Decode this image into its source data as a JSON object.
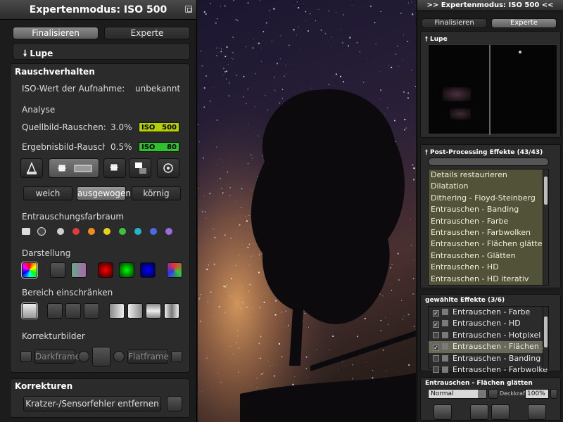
{
  "left": {
    "title": "Expertenmodus: ISO 500",
    "tabs": [
      {
        "label": "Finalisieren",
        "active": true
      },
      {
        "label": "Experte",
        "active": false
      }
    ],
    "lupe": "🠗 Lupe",
    "rausch": {
      "heading": "Rauschverhalten",
      "iso_label": "ISO-Wert der Aufnahme:",
      "iso_value": "unbekannt",
      "analyse": "Analyse",
      "quell_label": "Quellbild-Rauschen:",
      "quell_value": "3.0%",
      "quell_meter": {
        "iso": "ISO",
        "num": "500",
        "color": "#b4d000"
      },
      "ergeb_label": "Ergebnisbild-Rauschen:",
      "ergeb_value": "0.5%",
      "ergeb_meter": {
        "iso": "ISO",
        "num": "80",
        "color": "#2fc22f"
      },
      "grain_buttons": [
        "weich",
        "ausgewogen",
        "körnig"
      ],
      "grain_selected": "ausgewogen",
      "farbraum_label": "Entrauschungsfarbraum",
      "farbraum_colors": [
        "#cfcfcf",
        "#e23a3a",
        "#f08c1a",
        "#e5d21a",
        "#3ec23e",
        "#20b8c8",
        "#4a6be0",
        "#9a6ae0"
      ],
      "darstellung_label": "Darstellung",
      "bereich_label": "Bereich einschränken",
      "korrektur_label": "Korrekturbilder",
      "darkframe": "Darkframe",
      "flatframe": "Flatframe"
    },
    "korrekturen": {
      "heading": "Korrekturen",
      "button": "Kratzer-/Sensorfehler entfernen"
    }
  },
  "right": {
    "title": ">> Expertenmodus: ISO 500 <<",
    "tabs": [
      {
        "label": "Finalisieren",
        "active": false
      },
      {
        "label": "Experte",
        "active": true
      }
    ],
    "lupe": "🠕 Lupe",
    "post": {
      "heading": "🠕 Post-Processing Effekte (43/43)",
      "items": [
        "Details restaurieren",
        "Dilatation",
        "Dithering - Floyd-Steinberg",
        "Entrauschen - Banding",
        "Entrauschen - Farbe",
        "Entrauschen - Farbwolken",
        "Entrauschen - Flächen glätten",
        "Entrauschen - Glätten",
        "Entrauschen - HD",
        "Entrauschen - HD iterativ"
      ]
    },
    "chosen": {
      "heading": "gewählte Effekte (3/6)",
      "items": [
        {
          "label": "Entrauschen - Farbe",
          "checked": true,
          "selected": false
        },
        {
          "label": "Entrauschen - HD",
          "checked": true,
          "selected": false
        },
        {
          "label": "Entrauschen - Hotpixel",
          "checked": false,
          "selected": false
        },
        {
          "label": "Entrauschen - Flächen ...",
          "checked": true,
          "selected": true
        },
        {
          "label": "Entrauschen - Banding",
          "checked": false,
          "selected": false
        },
        {
          "label": "Entrauschen - Farbwolken",
          "checked": false,
          "selected": false
        }
      ]
    },
    "effect": {
      "heading": "Entrauschen - Flächen glätten",
      "mode": "Normal",
      "deckkraft_label": "Deckkraft",
      "deckkraft_value": "100%"
    }
  }
}
